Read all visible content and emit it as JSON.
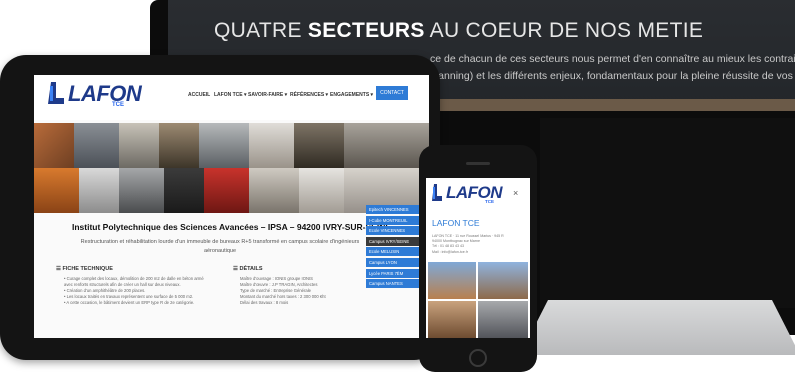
{
  "monitor": {
    "headline_pre": "QUATRE",
    "headline_bold": "SECTEURS",
    "headline_post": "AU COEUR DE NOS METIE",
    "line1": "ce de chacun de ces secteurs nous permet d'en connaître au mieux les contraintes",
    "line2": "planning) et les différents enjeux, fondamentaux pour la pleine réussite de vos proj"
  },
  "tablet": {
    "logo": "LAFON",
    "logo_sub": "TCE",
    "nav": [
      "ACCUEIL",
      "LAFON TCE ▾",
      "SAVOIR-FAIRE ▾",
      "RÉFÉRENCES ▾",
      "ENGAGEMENTS ▾"
    ],
    "contact": "CONTACT",
    "project_title": "Institut Polytechnique des Sciences Avancées – IPSA – 94200 IVRY-SUR-SEINE",
    "project_desc": "Restructuration et réhabilitation lourde d'un immeuble de bureaux R+5 transformé en campus scolaire d'ingénieurs aéronautique",
    "section1": "FICHE TECHNIQUE",
    "section2": "DÉTAILS",
    "list1": [
      "• Curage complet des locaux, démolition de 200 m2 de dalle en béton armé",
      "avec renforts structurels afin de créer un hall sur deux niveaux.",
      "• Création d'un amphithéâtre de 200 places.",
      "• Les locaux traités en travaux représentent une surface de 5 000 m2.",
      "• A cette occasion, le bâtiment devient un ERP type R de 2e catégorie."
    ],
    "list2": [
      "Maître d'ouvrage : IONIS groupe IONIS",
      "Maître d'œuvre : J.P TRAGIN, Architectes",
      "Type de marché : Entreprise Générale",
      "Montant du marché hors taxes : 2 300 000 €ht",
      "Délai des travaux : 8 mois"
    ],
    "campus": [
      "Epitech VINCENNES",
      "I-Cube MONTREUIL",
      "Ecole VINCENNES",
      "Campus IVRY/SEINE",
      "Ecole MELUSIN",
      "Campus LYON",
      "Lycée PARIS 7ÈM",
      "Campus NANTES"
    ],
    "campus_active_index": 3
  },
  "phone": {
    "logo": "LAFON",
    "logo_sub": "TCE",
    "menu_icon": "close-icon",
    "title": "LAFON TCE",
    "info": [
      "LAFON TCE · 11 rue Roussel Marius · 945 R",
      "94000 Montbugnac sur Marne",
      "Tél : 01 48 83 43 43",
      "Mail : info@lafon-tce.fr"
    ]
  },
  "colors": {
    "brand_blue": "#1e3a8a",
    "accent_blue": "#2e7bd6",
    "device_black": "#141414"
  }
}
